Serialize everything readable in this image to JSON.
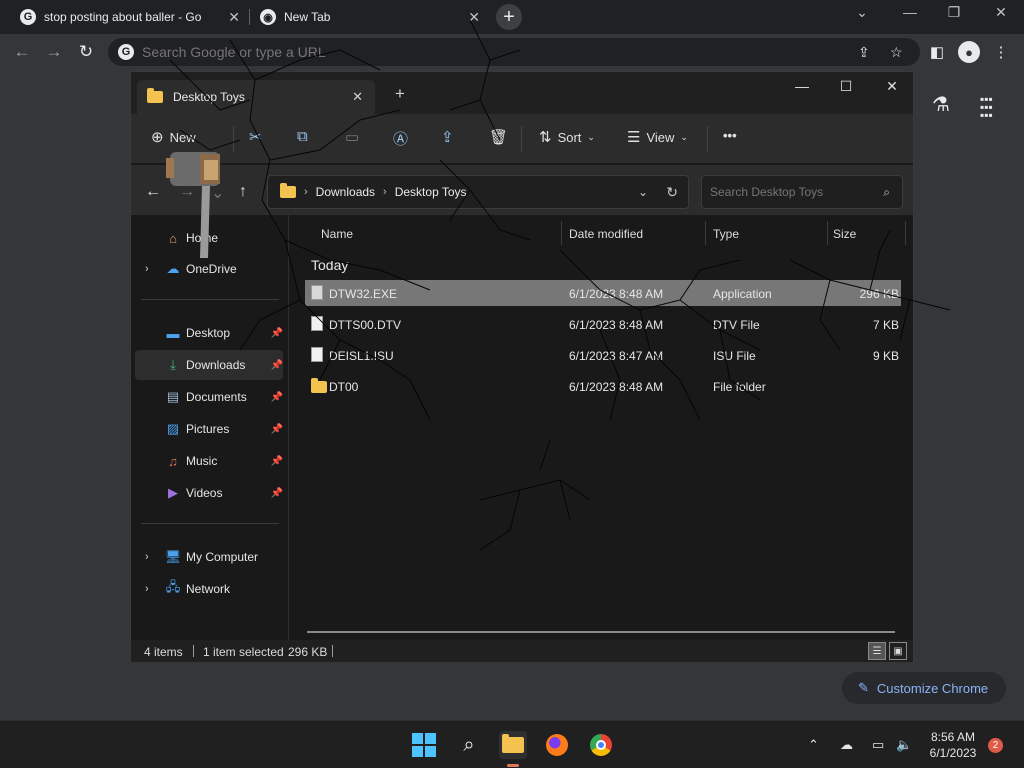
{
  "chrome": {
    "tabs": [
      {
        "title": "stop posting about baller - Go",
        "favicon": "G",
        "close": "✕"
      },
      {
        "title": "New Tab",
        "favicon": "◉",
        "close": "✕"
      }
    ],
    "new_tab": "+",
    "window_controls": {
      "dropdown": "⌄",
      "minimize": "—",
      "restore": "❐",
      "close": "✕"
    },
    "omnibox": {
      "placeholder": "Search Google or type a URL",
      "favicon": "G"
    },
    "labs_icon": "⚗",
    "apps_icon": "⋮⋮⋮",
    "customize_label": "Customize Chrome"
  },
  "explorer": {
    "tab_title": "Desktop Toys",
    "commands": {
      "new": "New",
      "sort": "Sort",
      "view": "View",
      "more": "•••"
    },
    "breadcrumb": [
      "Downloads",
      "Desktop Toys"
    ],
    "search_placeholder": "Search Desktop Toys",
    "sidebar": {
      "home": "Home",
      "onedrive": "OneDrive",
      "desktop": "Desktop",
      "downloads": "Downloads",
      "documents": "Documents",
      "pictures": "Pictures",
      "music": "Music",
      "videos": "Videos",
      "my_computer": "My Computer",
      "network": "Network"
    },
    "columns": {
      "name": "Name",
      "date": "Date modified",
      "type": "Type",
      "size": "Size"
    },
    "group": "Today",
    "files": [
      {
        "name": "DTW32.EXE",
        "date": "6/1/2023 8:48 AM",
        "type": "Application",
        "size": "296 KB",
        "selected": true,
        "icon": "app-icon"
      },
      {
        "name": "DTTS00.DTV",
        "date": "6/1/2023 8:48 AM",
        "type": "DTV File",
        "size": "7 KB",
        "icon": "file-icon"
      },
      {
        "name": "DEISL1.ISU",
        "date": "6/1/2023 8:47 AM",
        "type": "ISU File",
        "size": "9 KB",
        "icon": "file-icon"
      },
      {
        "name": "DT00",
        "date": "6/1/2023 8:48 AM",
        "type": "File folder",
        "size": "",
        "icon": "folder-icon"
      }
    ],
    "status": {
      "items": "4 items",
      "selected": "1 item selected",
      "size": "296 KB"
    }
  },
  "taskbar": {
    "time": "8:56 AM",
    "date": "6/1/2023",
    "notifications": "2"
  },
  "colors": {
    "accent": "#4cc2ff",
    "folder": "#f3c24f",
    "chrome_link": "#8ab4f8",
    "selection": "#777777"
  }
}
